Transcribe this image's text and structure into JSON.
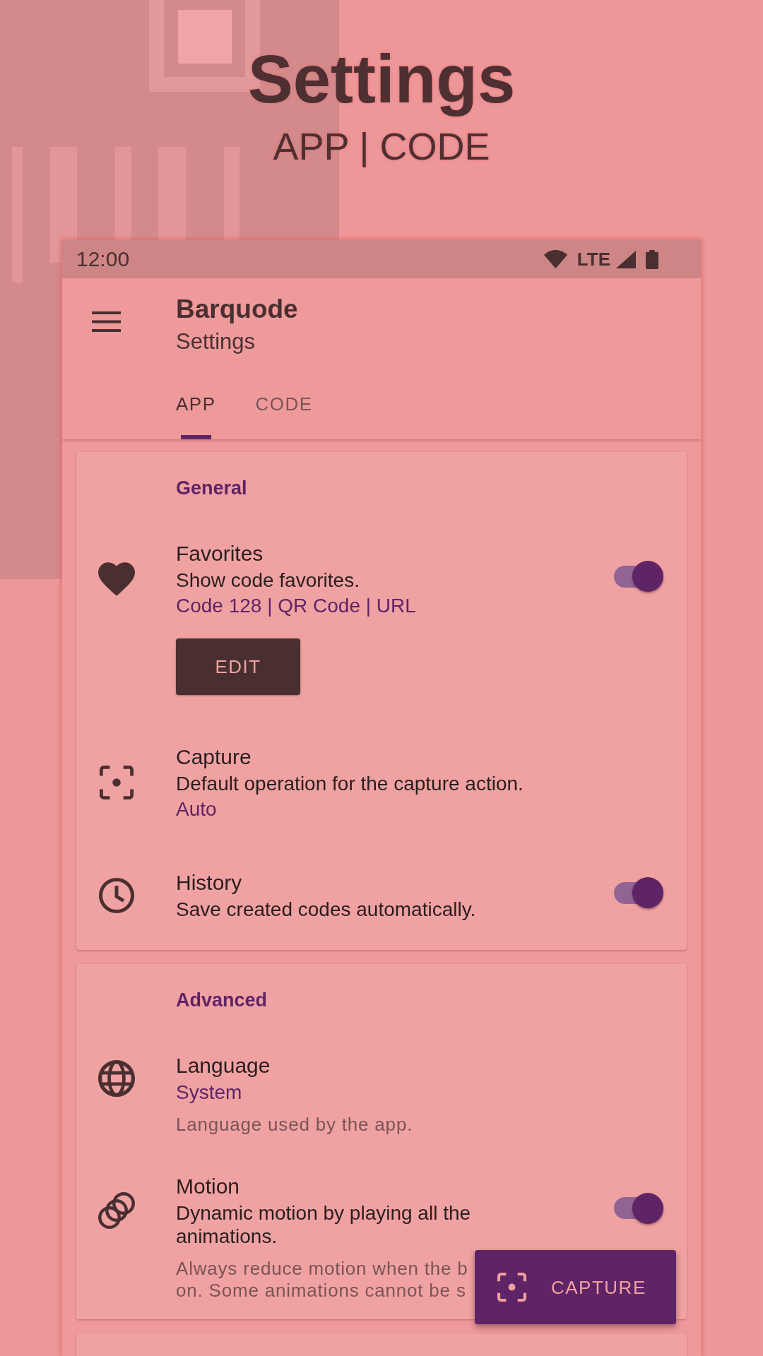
{
  "header": {
    "title": "Settings",
    "subtitle": "APP | CODE"
  },
  "status_bar": {
    "time": "12:00",
    "network": "LTE"
  },
  "app_bar": {
    "title": "Barquode",
    "subtitle": "Settings"
  },
  "tabs": [
    {
      "label": "APP",
      "selected": true
    },
    {
      "label": "CODE",
      "selected": false
    }
  ],
  "sections": [
    {
      "title": "General",
      "items": [
        {
          "kind": "switch",
          "title": "Favorites",
          "summary": "Show code favorites.",
          "value": "Code 128 | QR Code | URL",
          "on": true,
          "button": "EDIT"
        },
        {
          "kind": "choice",
          "title": "Capture",
          "summary": "Default operation for the capture action.",
          "value": "Auto"
        },
        {
          "kind": "switch",
          "title": "History",
          "summary": "Save created codes automatically.",
          "on": true
        }
      ]
    },
    {
      "title": "Advanced",
      "items": [
        {
          "kind": "choice",
          "title": "Language",
          "value": "System",
          "hint": "Language used by the app."
        },
        {
          "kind": "switch",
          "title": "Motion",
          "summary": "Dynamic motion by playing all the animations.",
          "on": true,
          "hint": "Always reduce motion when the b\non. Some animations cannot be s"
        }
      ]
    }
  ],
  "fab": {
    "label": "CAPTURE"
  }
}
